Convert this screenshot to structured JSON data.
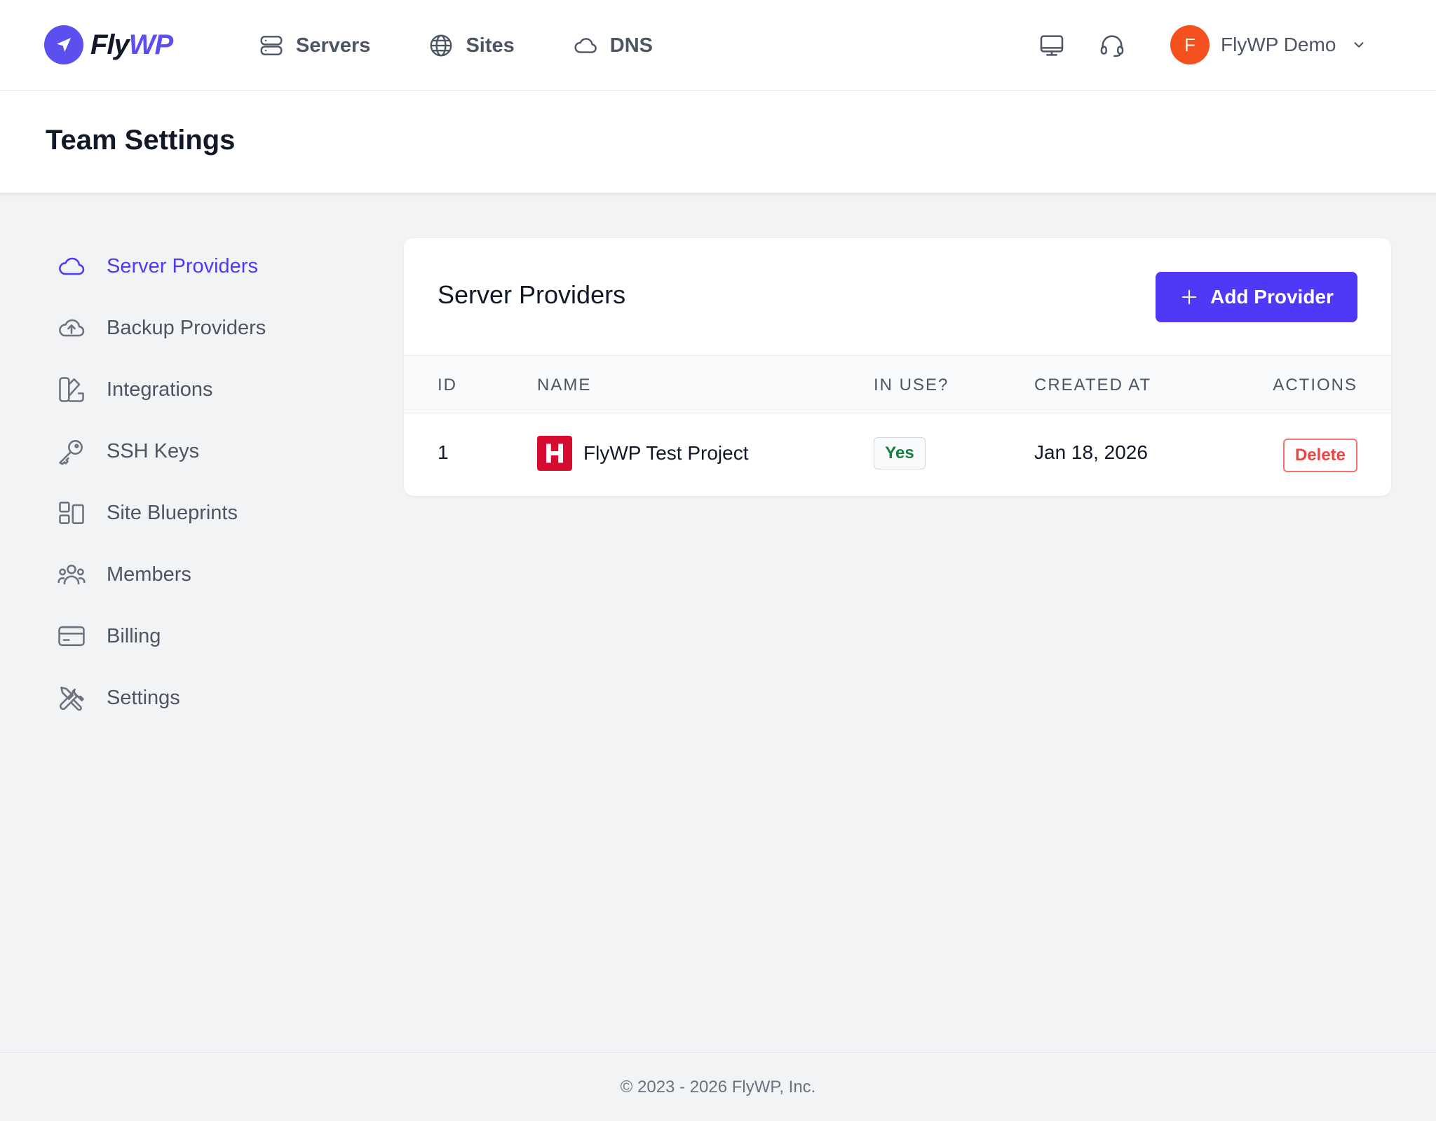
{
  "brand": {
    "logo_fly": "Fly",
    "logo_wp": "WP",
    "accent": "#4f39f6"
  },
  "nav": {
    "items": [
      {
        "label": "Servers",
        "icon": "server-icon"
      },
      {
        "label": "Sites",
        "icon": "globe-icon"
      },
      {
        "label": "DNS",
        "icon": "cloud-icon"
      }
    ]
  },
  "user": {
    "initial": "F",
    "name": "FlyWP Demo",
    "avatar_color": "#f4511e"
  },
  "page": {
    "title": "Team Settings"
  },
  "sidebar": {
    "items": [
      {
        "label": "Server Providers",
        "icon": "cloud-icon",
        "active": true
      },
      {
        "label": "Backup Providers",
        "icon": "cloud-upload-icon"
      },
      {
        "label": "Integrations",
        "icon": "swatch-icon"
      },
      {
        "label": "SSH Keys",
        "icon": "key-icon"
      },
      {
        "label": "Site Blueprints",
        "icon": "blueprint-icon"
      },
      {
        "label": "Members",
        "icon": "users-icon"
      },
      {
        "label": "Billing",
        "icon": "credit-card-icon"
      },
      {
        "label": "Settings",
        "icon": "tools-icon"
      }
    ]
  },
  "providers": {
    "title": "Server Providers",
    "add_label": "Add Provider",
    "columns": [
      "ID",
      "Name",
      "In Use?",
      "Created At",
      "Actions"
    ],
    "rows": [
      {
        "id": "1",
        "name": "FlyWP Test Project",
        "in_use": "Yes",
        "created_at": "Jan 18, 2026",
        "action": "Delete",
        "provider_icon": "hetzner-icon"
      }
    ]
  },
  "footer": {
    "text": "© 2023 - 2026 FlyWP, Inc."
  }
}
